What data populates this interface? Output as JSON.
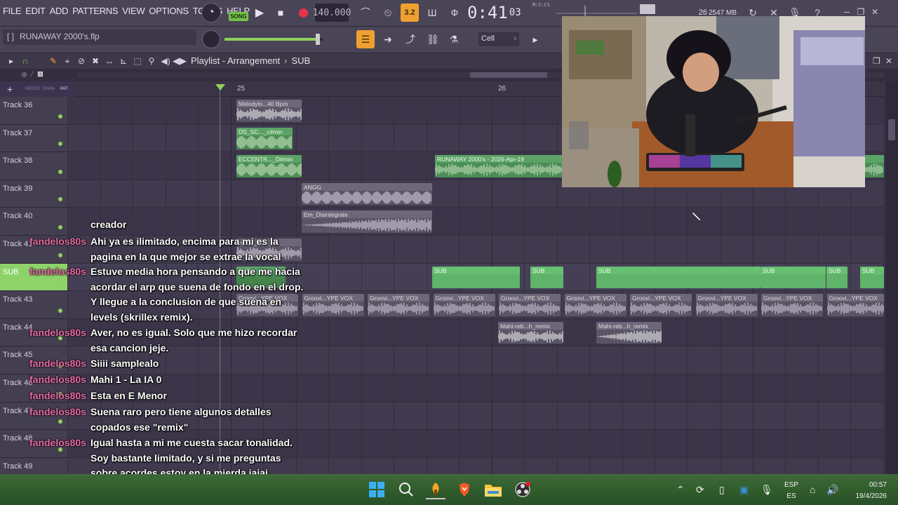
{
  "menu": [
    "FILE",
    "EDIT",
    "ADD",
    "PATTERNS",
    "VIEW",
    "OPTIONS",
    "TOOLS",
    "HELP"
  ],
  "transport": {
    "mode": "SONG",
    "tempo": "140.000",
    "time_main": "0:41",
    "time_sub": "03",
    "time_label": "M:S:CS",
    "step_badge": "3.2"
  },
  "status": {
    "cpu": "26",
    "memory": "2547 MB"
  },
  "project": {
    "hint_prefix": "[ ]",
    "file_name": "RUNAWAY 2000's.flp"
  },
  "snap": {
    "value": "Cell"
  },
  "playlist": {
    "title": "Playlist - Arrangement",
    "pattern": "SUB",
    "tool_labels": [
      "NOTES",
      "CHAN",
      "PAT"
    ],
    "ruler": [
      "25",
      "26"
    ]
  },
  "tracks": [
    "Track 36",
    "Track 37",
    "Track 38",
    "Track 39",
    "Track 40",
    "Track 41",
    "SUB",
    "Track 43",
    "Track 44",
    "Track 45",
    "Track 46",
    "Track 47",
    "Track 48",
    "Track 49"
  ],
  "clips": [
    {
      "label": "Melodylo...40 Bpm",
      "row": 0
    },
    {
      "label": "DS_SC..._c#min",
      "row": 1
    },
    {
      "label": "ECCENTR..._D#min",
      "row": 2
    },
    {
      "label": "RUNAWAY 2000's - 2026-Apr-19",
      "row": 2
    },
    {
      "label": "ANGG",
      "row": 3
    },
    {
      "label": "Em_Disintegrate",
      "row": 4
    },
    {
      "label": "emz2_Eb",
      "row": 5
    },
    {
      "label": "SUB",
      "row": 6
    },
    {
      "label": "Groovi...YPE VOX",
      "row": 7
    },
    {
      "label": "Mahi-reb...h_remix",
      "row": 8
    },
    {
      "label": "Apr-19",
      "row": 2
    }
  ],
  "chat": [
    {
      "user": "",
      "text": "creador"
    },
    {
      "user": "fandelos80s",
      "text": "Ahi ya es ilimitado, encima para mi es la pagina en la que mejor se extrae la vocal"
    },
    {
      "user": "fandelos80s",
      "text": "Estuve media hora pensando a que me hacia acordar el arp que suena de fondo en el drop. Y llegue a la conclusion de que suena en levels (skrillex remix)."
    },
    {
      "user": "fandelos80s",
      "text": "Aver, no es igual. Solo que me hizo recordar esa cancion jeje."
    },
    {
      "user": "fandelos80s",
      "text": "Siiii samplealo"
    },
    {
      "user": "fandelos80s",
      "text": "Mahi 1 - La IA 0"
    },
    {
      "user": "fandelos80s",
      "text": "Esta en E Menor"
    },
    {
      "user": "fandelos80s",
      "text": "Suena raro pero tiene algunos detalles copados ese \"remix\""
    },
    {
      "user": "fandelos80s",
      "text": "Igual hasta a mi me cuesta sacar tonalidad. Soy bastante limitado, y si me preguntas sobre acordes estoy en la mierda jajaj"
    }
  ],
  "taskbar": {
    "lang_top": "ESP",
    "lang_bottom": "ES",
    "time": "00:57",
    "date": "19/4/2026"
  },
  "icons": [
    "dial-icon",
    "play-icon",
    "stop-icon",
    "record-icon",
    "search-icon",
    "windows-start-icon",
    "fl-studio-icon",
    "brave-icon",
    "folder-icon",
    "obs-icon",
    "wifi-icon",
    "speaker-icon",
    "mic-icon"
  ],
  "colors": {
    "accent": "#f0a030",
    "green": "#8fd05b",
    "username": "#e66ba3",
    "background": "#3b3450"
  }
}
